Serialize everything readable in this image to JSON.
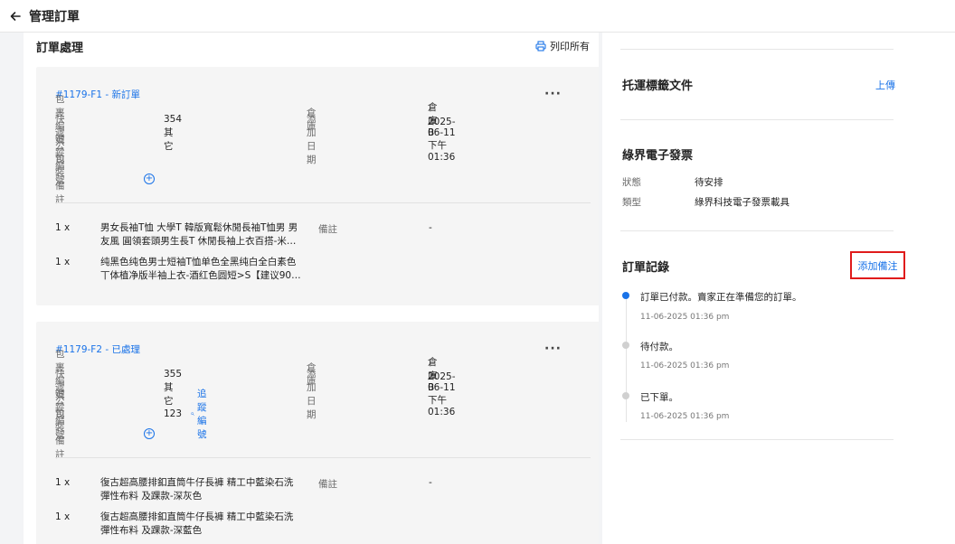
{
  "header": {
    "title": "管理訂單"
  },
  "orders_section": {
    "title": "訂單處理",
    "print_label": "列印所有"
  },
  "labels": {
    "package_no": "包裹編號",
    "courier": "快遞公司",
    "tracking_no": "追蹤編號",
    "package_note": "包裝備註",
    "warehouse": "倉庫",
    "date_added": "添加日期",
    "note": "備註"
  },
  "fulfillments": [
    {
      "order_label": "#1179-F1 - 新訂單",
      "package_no": "354",
      "courier": "其它",
      "tracking_no": "",
      "warehouse": "倉庫 B",
      "date_added": "2025-06-11 下午 01:36",
      "note_value": "-",
      "items": [
        {
          "qty": "1 x",
          "name_line1": "男女長袖T恤 大學T 韓版寬鬆休閒長袖T恤男 男",
          "name_line2": "友風 圓領套頭男生長T 休閒長袖上衣百搭-米…"
        },
        {
          "qty": "1 x",
          "name_line1": "纯黑色纯色男士短袖T恤单色全黑纯白全白素色",
          "name_line2": "丅体植净版半袖上衣-酒红色圆短>S【建议90…"
        }
      ]
    },
    {
      "order_label": "#1179-F2 - 已處理",
      "package_no": "355",
      "courier": "其它",
      "tracking_no": "123",
      "tracking_link": "追蹤編號",
      "warehouse": "倉庫 B",
      "date_added": "2025-06-11 下午 01:36",
      "note_value": "-",
      "items": [
        {
          "qty": "1 x",
          "name_line1": "復古超高腰排釦直筒牛仔長褲 精工中藍染石洗",
          "name_line2": "彈性布料 及踝款-深灰色"
        },
        {
          "qty": "1 x",
          "name_line1": "復古超高腰排釦直筒牛仔長褲 精工中藍染石洗",
          "name_line2": "彈性布料 及踝款-深藍色"
        }
      ]
    }
  ],
  "shipping_label": {
    "title": "托運標籤文件",
    "upload": "上傳"
  },
  "einvoice": {
    "title": "綠界電子發票",
    "status_label": "狀態",
    "status_value": "待安排",
    "type_label": "類型",
    "type_value": "綠界科技電子發票載具"
  },
  "order_log": {
    "title": "訂單記錄",
    "add_note": "添加備注",
    "entries": [
      {
        "title": "訂單已付款。賣家正在準備您的訂單。",
        "time": "11-06-2025 01:36 pm",
        "active": true
      },
      {
        "title": "待付款。",
        "time": "11-06-2025 01:36 pm",
        "active": false
      },
      {
        "title": "已下單。",
        "time": "11-06-2025 01:36 pm",
        "active": false
      }
    ]
  },
  "colors": {
    "accent": "#1a73e8",
    "highlight_border": "#e01b1b",
    "dot_active": "#1a73e8",
    "dot_inactive": "#d0d0d0"
  }
}
